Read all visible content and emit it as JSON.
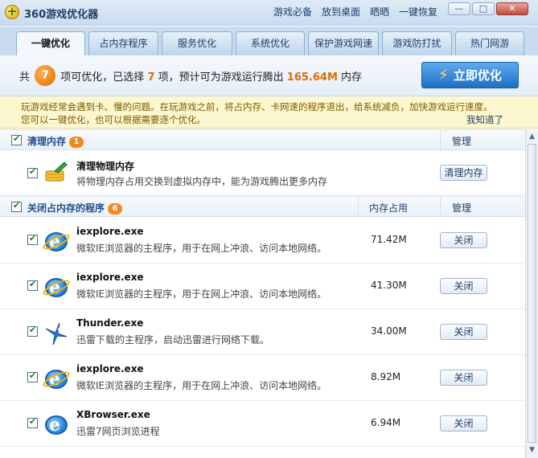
{
  "title": "360游戏优化器",
  "title_links": [
    "游戏必备",
    "放到桌面",
    "晒晒",
    "一键恢复"
  ],
  "window_controls": {
    "minimize": "—",
    "maximize": "□",
    "close": "✕"
  },
  "tabs": [
    {
      "label": "一键优化"
    },
    {
      "label": "占内存程序"
    },
    {
      "label": "服务优化"
    },
    {
      "label": "系统优化"
    },
    {
      "label": "保护游戏网速"
    },
    {
      "label": "游戏防打扰"
    },
    {
      "label": "热门网游"
    }
  ],
  "summary": {
    "prefix": "共",
    "total": "7",
    "text1": "项可优化，已选择",
    "selected": "7",
    "text2": "项，预计可为游戏运行腾出",
    "memory": "165.64M",
    "text3": "内存",
    "button": "立即优化"
  },
  "tip": {
    "line1": "玩游戏经常会遇到卡、慢的问题。在玩游戏之前，将占内存、卡网速的程序退出，给系统减负，加快游戏运行速度。",
    "line2": "您可以一键优化，也可以根据需要逐个优化。",
    "dismiss": "我知道了"
  },
  "group1": {
    "title": "清理内存",
    "count": "1",
    "manage": "管理",
    "item": {
      "name": "清理物理内存",
      "desc": "将物理内存占用交换到虚拟内存中，能为游戏腾出更多内存",
      "button": "清理内存"
    }
  },
  "group2": {
    "title": "关闭占内存的程序",
    "count": "6",
    "mem_header": "内存占用",
    "manage": "管理",
    "items": [
      {
        "name": "iexplore.exe",
        "desc": "微软IE浏览器的主程序，用于在网上冲浪、访问本地网络。",
        "mem": "71.42M",
        "button": "关闭",
        "icon": "ie-icon"
      },
      {
        "name": "iexplore.exe",
        "desc": "微软IE浏览器的主程序，用于在网上冲浪、访问本地网络。",
        "mem": "41.30M",
        "button": "关闭",
        "icon": "ie-icon"
      },
      {
        "name": "Thunder.exe",
        "desc": "迅雷下载的主程序，启动迅雷进行网络下载。",
        "mem": "34.00M",
        "button": "关闭",
        "icon": "thunder-icon"
      },
      {
        "name": "iexplore.exe",
        "desc": "微软IE浏览器的主程序，用于在网上冲浪、访问本地网络。",
        "mem": "8.92M",
        "button": "关闭",
        "icon": "ie-icon"
      },
      {
        "name": "XBrowser.exe",
        "desc": "迅雷7网页浏览进程",
        "mem": "6.94M",
        "button": "关闭",
        "icon": "xbrowser-icon"
      }
    ]
  }
}
